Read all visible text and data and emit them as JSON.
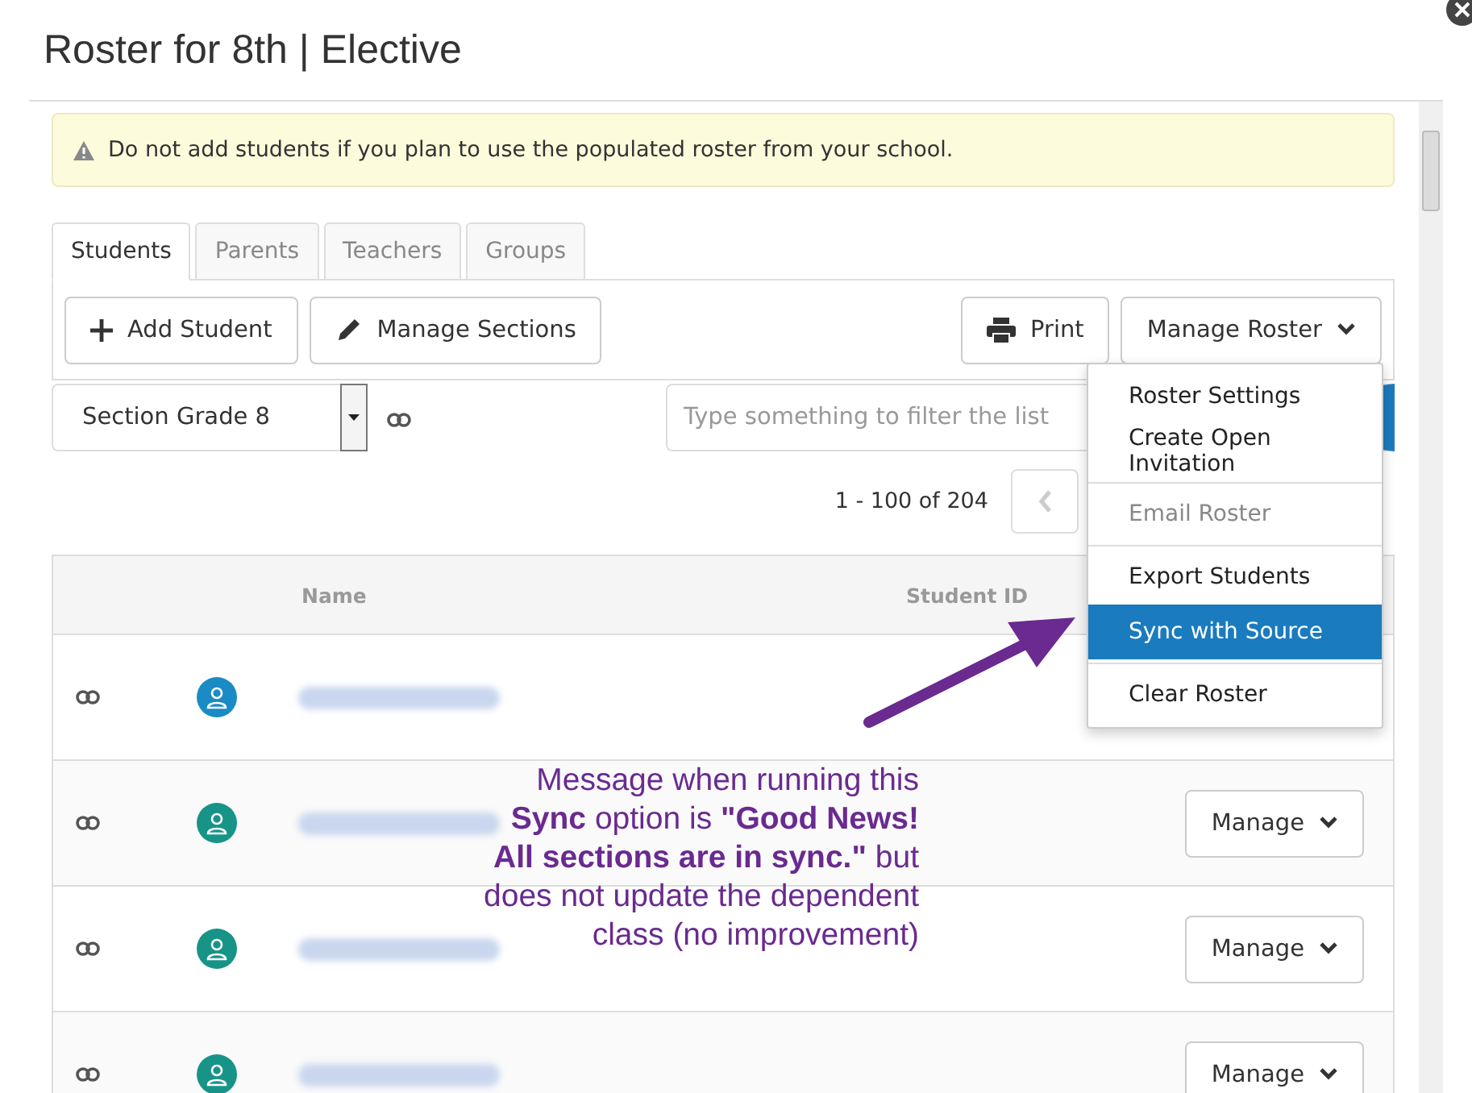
{
  "dialog": {
    "title": "Roster for 8th | Elective"
  },
  "alert": {
    "text": "Do not add students if you plan to use the populated roster from your school."
  },
  "tabs": [
    {
      "label": "Students",
      "selected": true
    },
    {
      "label": "Parents",
      "selected": false
    },
    {
      "label": "Teachers",
      "selected": false
    },
    {
      "label": "Groups",
      "selected": false
    }
  ],
  "toolbar": {
    "add_button": "Add Student",
    "sections_button": "Manage Sections",
    "print_button": "Print",
    "roster_button": "Manage Roster"
  },
  "section_select": {
    "value": "Section Grade 8"
  },
  "filter": {
    "placeholder": "Type something to filter the list"
  },
  "pagination": {
    "range": "1 - 100 of 204"
  },
  "table": {
    "columns": [
      "Name",
      "Student ID"
    ],
    "rows": [
      {
        "color": "#1a8bc4",
        "manage": null
      },
      {
        "color": "#179487",
        "manage": "Manage"
      },
      {
        "color": "#179487",
        "manage": "Manage"
      },
      {
        "color": "#179487",
        "manage": "Manage"
      }
    ]
  },
  "roster_menu": [
    {
      "kind": "item",
      "label": "Roster Settings",
      "disabled": false,
      "selected": false
    },
    {
      "kind": "item",
      "label": "Create Open Invitation",
      "disabled": false,
      "selected": false
    },
    {
      "kind": "divider"
    },
    {
      "kind": "item",
      "label": "Email Roster",
      "disabled": true,
      "selected": false
    },
    {
      "kind": "divider"
    },
    {
      "kind": "item",
      "label": "Export Students",
      "disabled": false,
      "selected": false
    },
    {
      "kind": "item",
      "label": "Sync with Source",
      "disabled": false,
      "selected": true
    },
    {
      "kind": "divider"
    },
    {
      "kind": "item",
      "label": "Clear Roster",
      "disabled": false,
      "selected": false
    }
  ],
  "annotation": {
    "text": "Message when running this **Sync** option is **\"Good News! All sections are in sync.\"** but does not update the dependent class (no improvement)"
  }
}
